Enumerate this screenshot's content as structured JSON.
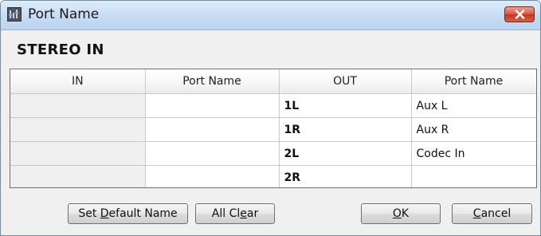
{
  "window": {
    "title": "Port Name",
    "close_icon": "close-x-icon"
  },
  "section": {
    "title": "STEREO IN"
  },
  "table": {
    "headers": [
      "IN",
      "Port Name",
      "OUT",
      "Port Name"
    ],
    "rows": [
      {
        "in": "",
        "in_port_name": "",
        "out": "1L",
        "out_port_name": "Aux L"
      },
      {
        "in": "",
        "in_port_name": "",
        "out": "1R",
        "out_port_name": "Aux R"
      },
      {
        "in": "",
        "in_port_name": "",
        "out": "2L",
        "out_port_name": "Codec In"
      },
      {
        "in": "",
        "in_port_name": "",
        "out": "2R",
        "out_port_name": ""
      }
    ]
  },
  "buttons": {
    "set_default": {
      "pre": "Set ",
      "mnemonic": "D",
      "post": "efault Name"
    },
    "all_clear": {
      "pre": "All Cl",
      "mnemonic": "e",
      "post": "ar"
    },
    "ok": {
      "pre": "",
      "mnemonic": "O",
      "post": "K"
    },
    "cancel": {
      "pre": "",
      "mnemonic": "C",
      "post": "ancel"
    }
  },
  "colors": {
    "title_bar": "#c7dcf3",
    "close_button": "#d9553f",
    "dialog_bg": "#f0f0f0",
    "in_cell_bg": "#f0f0f0"
  }
}
